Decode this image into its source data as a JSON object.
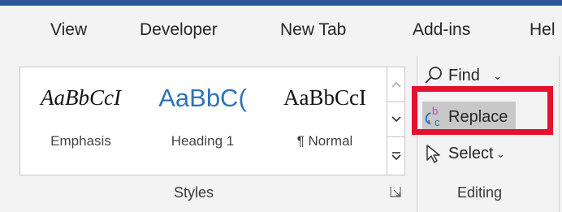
{
  "tabs": [
    "View",
    "Developer",
    "New Tab",
    "Add-ins",
    "Hel"
  ],
  "styles_group": {
    "label": "Styles",
    "items": [
      {
        "preview": "AaBbCcI",
        "name": "Emphasis"
      },
      {
        "preview": "AaBbC(",
        "name": "Heading 1"
      },
      {
        "preview": "AaBbCcI",
        "name": "¶ Normal"
      }
    ]
  },
  "editing_group": {
    "label": "Editing",
    "find_label": "Find",
    "replace_label": "Replace",
    "select_label": "Select"
  },
  "colors": {
    "accent": "#2b5797",
    "highlight": "#e5102b",
    "heading_blue": "#2e74b5",
    "replace_bg": "#c8c8c8"
  }
}
